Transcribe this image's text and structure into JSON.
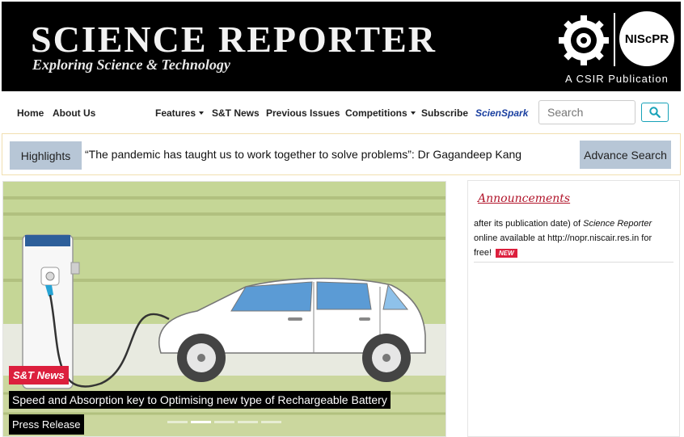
{
  "header": {
    "title": "SCIENCE REPORTER",
    "tagline": "Exploring Science & Technology",
    "logo_text": "NIScPR",
    "publication": "A CSIR Publication"
  },
  "nav": {
    "home": "Home",
    "about": "About Us",
    "features": "Features",
    "st_news": "S&T News",
    "previous_issues": "Previous Issues",
    "competitions": "Competitions",
    "subscribe": "Subscribe",
    "scienspark": "ScienSpark",
    "search_placeholder": "Search"
  },
  "highlights": {
    "label": "Highlights",
    "text": "“The pandemic has taught us to work together to solve problems”: Dr Gagandeep Kang",
    "advance_search": "Advance Search"
  },
  "slider": {
    "category": "S&T News",
    "headline": "Speed and Absorption key to Optimising new type of Rechargeable Battery",
    "source": "Press Release",
    "slide_count": 5,
    "active_slide": 2
  },
  "announcements": {
    "title": "Announcements",
    "text_before": "after its publication date) of ",
    "text_italic": "Science Reporter",
    "text_after": " online available at http://nopr.niscair.res.in for free!",
    "badge": "NEW"
  },
  "colors": {
    "banner_bg": "#000000",
    "tag_red": "#dc1f3d",
    "button_blue_grey": "#b7c6d6",
    "scene_green": "#c5d696",
    "announcement_red": "#b1142a"
  }
}
